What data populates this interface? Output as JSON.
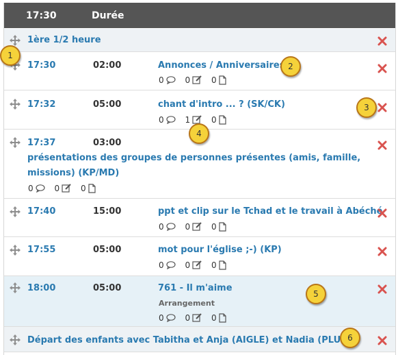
{
  "header": {
    "time": "17:30",
    "duration": "Durée"
  },
  "sections": {
    "first": {
      "title": "1ère 1/2 heure"
    },
    "depart": {
      "title": "Départ des enfants avec Tabitha et Anja (AIGLE) et Nadia (PLUME)"
    }
  },
  "items": [
    {
      "time": "17:30",
      "duration": "02:00",
      "title": "Annonces / Anniversaires",
      "comments": "0",
      "notes": "0",
      "files": "0"
    },
    {
      "time": "17:32",
      "duration": "05:00",
      "title": "chant d'intro ... ? (SK/CK)",
      "comments": "0",
      "notes": "1",
      "files": "0"
    },
    {
      "time": "17:37",
      "duration": "03:00",
      "title": "présentations des groupes de personnes présentes (amis, famille, missions) (KP/MD)",
      "comments": "0",
      "notes": "0",
      "files": "0"
    },
    {
      "time": "17:40",
      "duration": "15:00",
      "title": "ppt et clip sur le Tchad et le travail à Abéché",
      "comments": "0",
      "notes": "0",
      "files": "0"
    },
    {
      "time": "17:55",
      "duration": "05:00",
      "title": "mot pour l'église ;-) (KP)",
      "comments": "0",
      "notes": "0",
      "files": "0"
    },
    {
      "time": "18:00",
      "duration": "05:00",
      "title": "761 - Il m'aime",
      "subtitle": "Arrangement",
      "comments": "0",
      "notes": "0",
      "files": "0"
    }
  ],
  "callouts": [
    "1",
    "2",
    "3",
    "4",
    "5",
    "6"
  ],
  "colors": {
    "header_bg": "#555555",
    "link": "#2a7ab0",
    "delete": "#d9534f",
    "section_bg": "#eef2f5",
    "selected_bg": "#e6f1f7",
    "callout": "#f5d23a"
  }
}
